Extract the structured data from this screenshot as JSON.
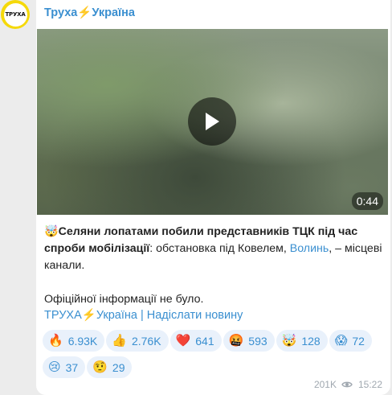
{
  "channel": {
    "name": "Труха⚡Україна",
    "avatar_text": "ТРУХА"
  },
  "video": {
    "duration": "0:44"
  },
  "post": {
    "emoji_lead": "🤯",
    "headline": "Селяни лопатами побили представників ТЦК під час спроби мобілізації",
    "body_before_link": ": обстановка під Ковелем, ",
    "link_text": "Волинь",
    "body_after_link": ", – місцеві канали.",
    "paragraph2": "Офіційної інформації не було."
  },
  "footer": {
    "links_text": "ТРУХА⚡Україна | Надіслати новину"
  },
  "reactions": [
    {
      "emoji": "🔥",
      "count": "6.93K"
    },
    {
      "emoji": "👍",
      "count": "2.76K"
    },
    {
      "emoji": "❤️",
      "count": "641"
    },
    {
      "emoji": "🤬",
      "count": "593"
    },
    {
      "emoji": "🤯",
      "count": "128"
    },
    {
      "emoji": "😱",
      "count": "72"
    },
    {
      "emoji": "😢",
      "count": "37"
    },
    {
      "emoji": "🤨",
      "count": "29"
    }
  ],
  "meta": {
    "views": "201K",
    "time": "15:22"
  },
  "colors": {
    "accent": "#3a8fd0",
    "avatar_ring": "#f5d90a",
    "reaction_bg": "#e9f1fb"
  }
}
